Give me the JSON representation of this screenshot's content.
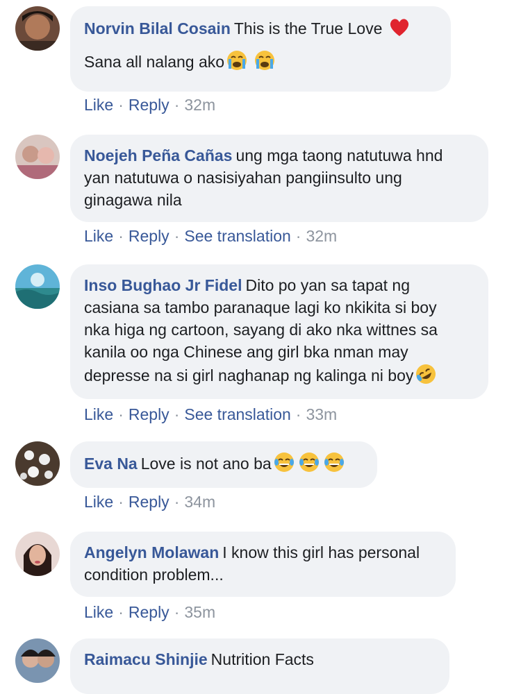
{
  "comments": [
    {
      "author": "Norvin Bilal Cosain",
      "lines": [
        "This is the True Love",
        "Sana all nalang ako"
      ],
      "emojis": [
        "red-heart",
        "loudly-crying",
        "loudly-crying"
      ],
      "actions": [
        "Like",
        "Reply"
      ],
      "time": "32m"
    },
    {
      "author": "Noejeh Peña Cañas",
      "lines": [
        "ung mga taong natutuwa hnd",
        "yan natutuwa o nasisiyahan pangiinsulto ung",
        "ginagawa nila"
      ],
      "actions": [
        "Like",
        "Reply",
        "See translation"
      ],
      "time": "32m"
    },
    {
      "author": "Inso Bughao Jr Fidel",
      "lines": [
        "Dito po yan sa tapat ng",
        "casiana sa tambo paranaque lagi ko nkikita si boy",
        "nka higa ng cartoon, sayang di ako nka wittnes sa",
        "kanila oo nga Chinese ang girl bka nman may",
        "depresse na si girl naghanap ng kalinga ni boy"
      ],
      "emojis": [
        "rolling-laughing"
      ],
      "actions": [
        "Like",
        "Reply",
        "See translation"
      ],
      "time": "33m"
    },
    {
      "author": "Eva Na",
      "lines": [
        "Love is not ano ba"
      ],
      "emojis": [
        "tears-of-joy",
        "tears-of-joy",
        "tears-of-joy"
      ],
      "actions": [
        "Like",
        "Reply"
      ],
      "time": "34m"
    },
    {
      "author": "Angelyn Molawan",
      "lines": [
        "I know this girl has personal",
        "condition problem..."
      ],
      "actions": [
        "Like",
        "Reply"
      ],
      "time": "35m"
    },
    {
      "author": "Raimacu Shinjie",
      "lines": [
        "Nutrition Facts"
      ]
    }
  ],
  "separator": "·",
  "colors": {
    "link": "#385898",
    "bubble": "#f0f2f5",
    "meta": "#8d949e",
    "text": "#1c1e21"
  }
}
